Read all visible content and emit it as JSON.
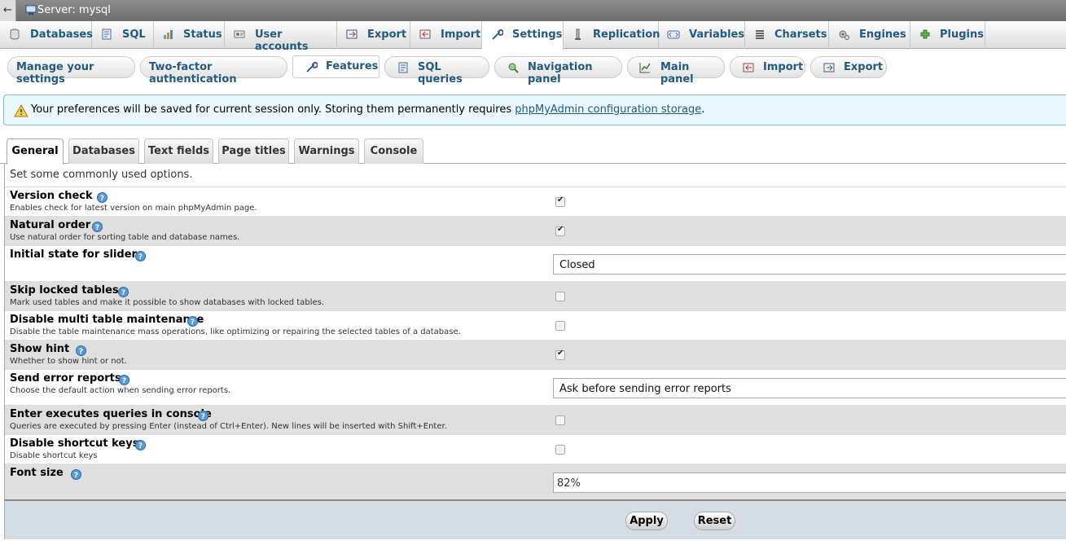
{
  "topbar": {
    "collapse_label": "←",
    "server_label": "Server: mysql",
    "server_icon": "server-icon"
  },
  "main_tabs": [
    {
      "label": "Databases",
      "icon": "database-icon"
    },
    {
      "label": "SQL",
      "icon": "sql-icon"
    },
    {
      "label": "Status",
      "icon": "status-icon"
    },
    {
      "label": "User accounts",
      "icon": "user-accounts-icon"
    },
    {
      "label": "Export",
      "icon": "export-icon"
    },
    {
      "label": "Import",
      "icon": "import-icon"
    },
    {
      "label": "Settings",
      "icon": "wrench-icon",
      "active": true
    },
    {
      "label": "Replication",
      "icon": "replication-icon"
    },
    {
      "label": "Variables",
      "icon": "variables-icon"
    },
    {
      "label": "Charsets",
      "icon": "charsets-icon"
    },
    {
      "label": "Engines",
      "icon": "engines-icon"
    },
    {
      "label": "Plugins",
      "icon": "plugins-icon"
    }
  ],
  "sub_tabs": [
    {
      "label": "Manage your settings"
    },
    {
      "label": "Two-factor authentication"
    },
    {
      "label": "Features",
      "icon": "wrench-icon",
      "active": true
    },
    {
      "label": "SQL queries",
      "icon": "sql-icon"
    },
    {
      "label": "Navigation panel",
      "icon": "navigation-icon"
    },
    {
      "label": "Main panel",
      "icon": "main-panel-icon"
    },
    {
      "label": "Import",
      "icon": "import-icon"
    },
    {
      "label": "Export",
      "icon": "export-icon"
    }
  ],
  "notice": {
    "text": "Your preferences will be saved for current session only. Storing them permanently requires",
    "link": "phpMyAdmin configuration storage",
    "suffix": "."
  },
  "page_tabs": [
    {
      "label": "General",
      "active": true
    },
    {
      "label": "Databases"
    },
    {
      "label": "Text fields"
    },
    {
      "label": "Page titles"
    },
    {
      "label": "Warnings"
    },
    {
      "label": "Console"
    }
  ],
  "form": {
    "intro": "Set some commonly used options.",
    "rows": [
      {
        "label": "Version check",
        "desc": "Enables check for latest version on main phpMyAdmin page.",
        "type": "checkbox",
        "checked": true
      },
      {
        "label": "Natural order",
        "desc": "Use natural order for sorting table and database names.",
        "type": "checkbox",
        "checked": true
      },
      {
        "label": "Initial state for sliders",
        "desc": "",
        "type": "select",
        "value": "Closed"
      },
      {
        "label": "Skip locked tables",
        "desc": "Mark used tables and make it possible to show databases with locked tables.",
        "type": "checkbox",
        "checked": false
      },
      {
        "label": "Disable multi table maintenance",
        "desc": "Disable the table maintenance mass operations, like optimizing or repairing the selected tables of a database.",
        "type": "checkbox",
        "checked": false
      },
      {
        "label": "Show hint",
        "desc": "Whether to show hint or not.",
        "type": "checkbox",
        "checked": true
      },
      {
        "label": "Send error reports",
        "desc": "Choose the default action when sending error reports.",
        "type": "select",
        "value": "Ask before sending error reports"
      },
      {
        "label": "Enter executes queries in console",
        "desc": "Queries are executed by pressing Enter (instead of Ctrl+Enter). New lines will be inserted with Shift+Enter.",
        "type": "checkbox",
        "checked": false
      },
      {
        "label": "Disable shortcut keys",
        "desc": "Disable shortcut keys",
        "type": "checkbox",
        "checked": false
      },
      {
        "label": "Font size",
        "desc": "",
        "type": "text",
        "value": "82%"
      }
    ]
  },
  "footer": {
    "apply_label": "Apply",
    "reset_label": "Reset"
  },
  "colors": {
    "link": "#235a81",
    "notice_bg": "#ebf8fd",
    "alt_row": "#dfdfdf",
    "footer_bg": "#d5dde4"
  }
}
